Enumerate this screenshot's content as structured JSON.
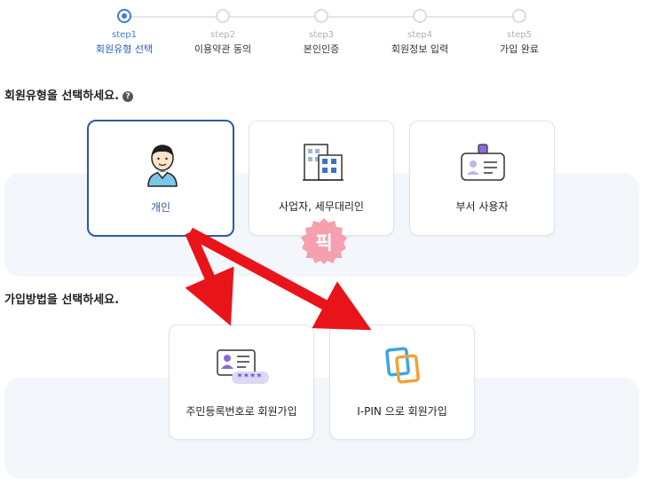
{
  "stepper": {
    "steps": [
      {
        "num": "step1",
        "label": "회원유형 선택"
      },
      {
        "num": "step2",
        "label": "이용약관 동의"
      },
      {
        "num": "step3",
        "label": "본인인증"
      },
      {
        "num": "step4",
        "label": "회원정보 입력"
      },
      {
        "num": "step5",
        "label": "가입 완료"
      }
    ],
    "active_index": 0
  },
  "member_type": {
    "title": "회원유형을 선택하세요.",
    "help_icon": "?",
    "options": [
      {
        "label": "개인",
        "icon": "person-icon",
        "selected": true
      },
      {
        "label": "사업자, 세무대리인",
        "icon": "building-icon",
        "selected": false
      },
      {
        "label": "부서 사용자",
        "icon": "id-badge-icon",
        "selected": false
      }
    ]
  },
  "pick_badge": {
    "text": "픽",
    "color": "#f5a0ae"
  },
  "join_method": {
    "title": "가입방법을 선택하세요.",
    "options": [
      {
        "label": "주민등록번호로 회원가입",
        "icon": "id-card-icon",
        "mask": "****"
      },
      {
        "label": "I-PIN 으로 회원가입",
        "icon": "ipin-icon"
      }
    ]
  },
  "colors": {
    "accent": "#2c5aa6",
    "step_active": "#3e7bd8",
    "arrow": "#e8141a",
    "band": "#f3f6fb"
  }
}
